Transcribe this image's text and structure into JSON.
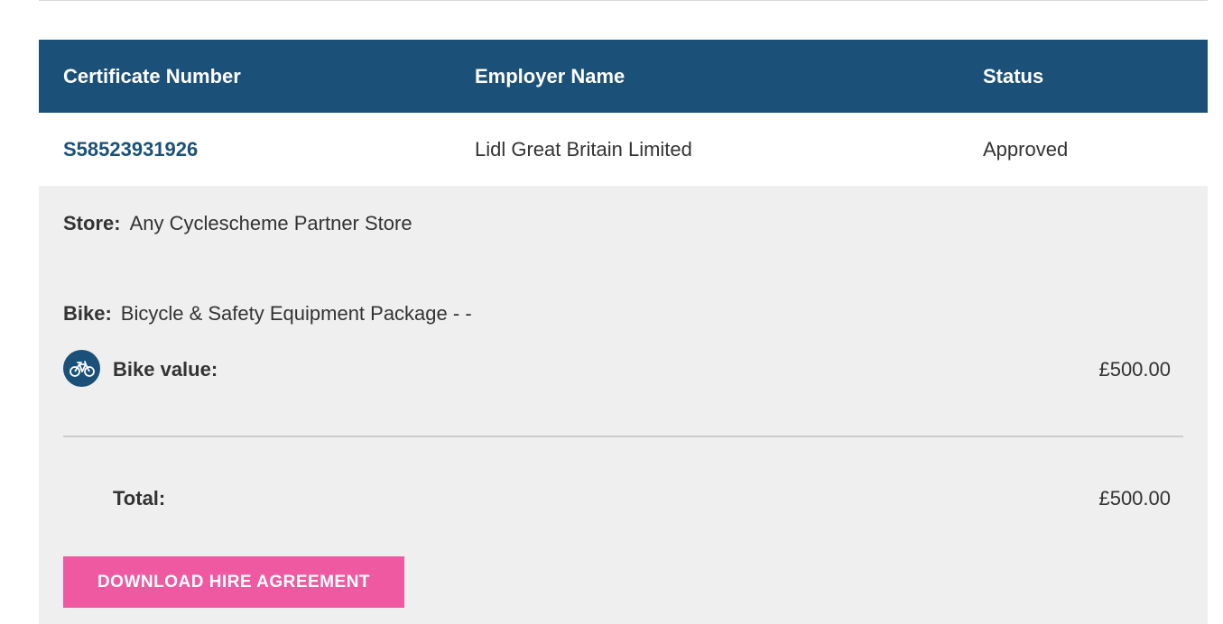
{
  "table": {
    "headers": {
      "certificate_number": "Certificate Number",
      "employer_name": "Employer Name",
      "status": "Status"
    },
    "row": {
      "certificate_number": "S58523931926",
      "employer_name": "Lidl Great Britain Limited",
      "status": "Approved"
    }
  },
  "details": {
    "store_label": "Store:",
    "store_value": "Any Cyclescheme Partner Store",
    "bike_label": "Bike:",
    "bike_value": "Bicycle & Safety Equipment Package - -",
    "bike_value_label": "Bike value:",
    "bike_value_amount": "£500.00",
    "total_label": "Total:",
    "total_amount": "£500.00",
    "bike_icon": "bicycle-icon"
  },
  "actions": {
    "download_label": "DOWNLOAD HIRE AGREEMENT"
  },
  "colors": {
    "header_bg": "#1b5179",
    "details_bg": "#efefef",
    "button_bg": "#ef59a2"
  }
}
